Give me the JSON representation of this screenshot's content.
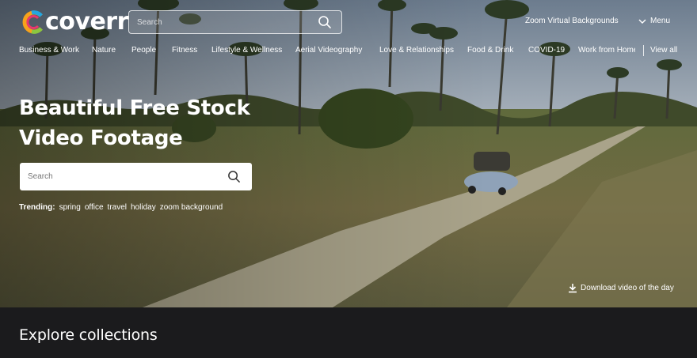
{
  "brand": {
    "name": "coverr"
  },
  "header": {
    "search_placeholder": "Search",
    "zoom_link": "Zoom Virtual Backgrounds",
    "menu_label": "Menu"
  },
  "categories": [
    "Business & Work",
    "Nature",
    "People",
    "Fitness",
    "Lifestyle & Wellness",
    "Aerial Videography",
    "Love & Relationships",
    "Food & Drink",
    "COVID-19",
    "Work from Home",
    "View all"
  ],
  "hero": {
    "title": "Beautiful Free Stock Video Footage",
    "search_placeholder": "Search",
    "trending_label": "Trending:",
    "trending": [
      "spring",
      "office",
      "travel",
      "holiday",
      "zoom background"
    ],
    "download_label": "Download video of the day"
  },
  "explore": {
    "title": "Explore collections"
  },
  "icons": {
    "search": "search-icon",
    "menu": "chevron-down-icon",
    "download": "download-icon"
  },
  "colors": {
    "logo_orange": "#f7a21b",
    "logo_pink": "#e8386d",
    "logo_blue": "#22a6e0",
    "logo_green": "#8cc63f",
    "footer_bg": "#1b1b1d"
  }
}
